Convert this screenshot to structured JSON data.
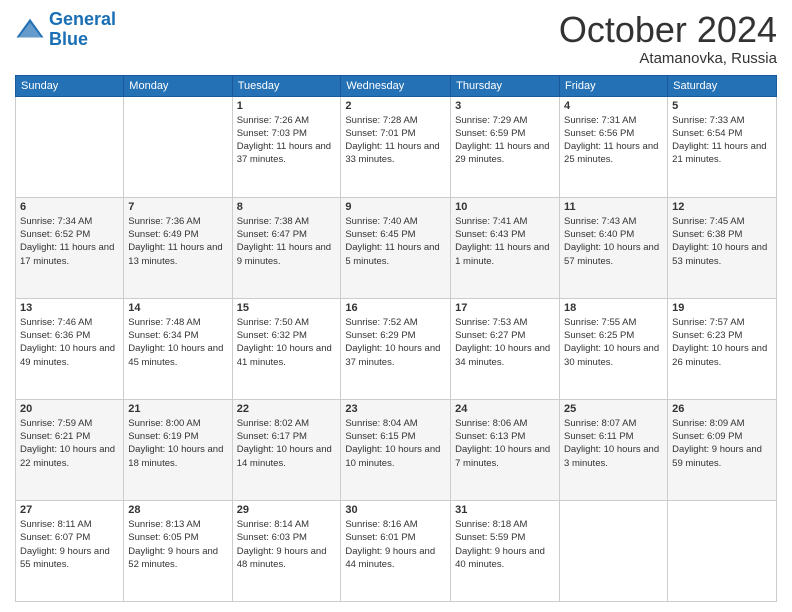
{
  "logo": {
    "line1": "General",
    "line2": "Blue"
  },
  "header": {
    "month": "October 2024",
    "location": "Atamanovka, Russia"
  },
  "days_of_week": [
    "Sunday",
    "Monday",
    "Tuesday",
    "Wednesday",
    "Thursday",
    "Friday",
    "Saturday"
  ],
  "weeks": [
    [
      {
        "day": "",
        "info": ""
      },
      {
        "day": "",
        "info": ""
      },
      {
        "day": "1",
        "info": "Sunrise: 7:26 AM\nSunset: 7:03 PM\nDaylight: 11 hours and 37 minutes."
      },
      {
        "day": "2",
        "info": "Sunrise: 7:28 AM\nSunset: 7:01 PM\nDaylight: 11 hours and 33 minutes."
      },
      {
        "day": "3",
        "info": "Sunrise: 7:29 AM\nSunset: 6:59 PM\nDaylight: 11 hours and 29 minutes."
      },
      {
        "day": "4",
        "info": "Sunrise: 7:31 AM\nSunset: 6:56 PM\nDaylight: 11 hours and 25 minutes."
      },
      {
        "day": "5",
        "info": "Sunrise: 7:33 AM\nSunset: 6:54 PM\nDaylight: 11 hours and 21 minutes."
      }
    ],
    [
      {
        "day": "6",
        "info": "Sunrise: 7:34 AM\nSunset: 6:52 PM\nDaylight: 11 hours and 17 minutes."
      },
      {
        "day": "7",
        "info": "Sunrise: 7:36 AM\nSunset: 6:49 PM\nDaylight: 11 hours and 13 minutes."
      },
      {
        "day": "8",
        "info": "Sunrise: 7:38 AM\nSunset: 6:47 PM\nDaylight: 11 hours and 9 minutes."
      },
      {
        "day": "9",
        "info": "Sunrise: 7:40 AM\nSunset: 6:45 PM\nDaylight: 11 hours and 5 minutes."
      },
      {
        "day": "10",
        "info": "Sunrise: 7:41 AM\nSunset: 6:43 PM\nDaylight: 11 hours and 1 minute."
      },
      {
        "day": "11",
        "info": "Sunrise: 7:43 AM\nSunset: 6:40 PM\nDaylight: 10 hours and 57 minutes."
      },
      {
        "day": "12",
        "info": "Sunrise: 7:45 AM\nSunset: 6:38 PM\nDaylight: 10 hours and 53 minutes."
      }
    ],
    [
      {
        "day": "13",
        "info": "Sunrise: 7:46 AM\nSunset: 6:36 PM\nDaylight: 10 hours and 49 minutes."
      },
      {
        "day": "14",
        "info": "Sunrise: 7:48 AM\nSunset: 6:34 PM\nDaylight: 10 hours and 45 minutes."
      },
      {
        "day": "15",
        "info": "Sunrise: 7:50 AM\nSunset: 6:32 PM\nDaylight: 10 hours and 41 minutes."
      },
      {
        "day": "16",
        "info": "Sunrise: 7:52 AM\nSunset: 6:29 PM\nDaylight: 10 hours and 37 minutes."
      },
      {
        "day": "17",
        "info": "Sunrise: 7:53 AM\nSunset: 6:27 PM\nDaylight: 10 hours and 34 minutes."
      },
      {
        "day": "18",
        "info": "Sunrise: 7:55 AM\nSunset: 6:25 PM\nDaylight: 10 hours and 30 minutes."
      },
      {
        "day": "19",
        "info": "Sunrise: 7:57 AM\nSunset: 6:23 PM\nDaylight: 10 hours and 26 minutes."
      }
    ],
    [
      {
        "day": "20",
        "info": "Sunrise: 7:59 AM\nSunset: 6:21 PM\nDaylight: 10 hours and 22 minutes."
      },
      {
        "day": "21",
        "info": "Sunrise: 8:00 AM\nSunset: 6:19 PM\nDaylight: 10 hours and 18 minutes."
      },
      {
        "day": "22",
        "info": "Sunrise: 8:02 AM\nSunset: 6:17 PM\nDaylight: 10 hours and 14 minutes."
      },
      {
        "day": "23",
        "info": "Sunrise: 8:04 AM\nSunset: 6:15 PM\nDaylight: 10 hours and 10 minutes."
      },
      {
        "day": "24",
        "info": "Sunrise: 8:06 AM\nSunset: 6:13 PM\nDaylight: 10 hours and 7 minutes."
      },
      {
        "day": "25",
        "info": "Sunrise: 8:07 AM\nSunset: 6:11 PM\nDaylight: 10 hours and 3 minutes."
      },
      {
        "day": "26",
        "info": "Sunrise: 8:09 AM\nSunset: 6:09 PM\nDaylight: 9 hours and 59 minutes."
      }
    ],
    [
      {
        "day": "27",
        "info": "Sunrise: 8:11 AM\nSunset: 6:07 PM\nDaylight: 9 hours and 55 minutes."
      },
      {
        "day": "28",
        "info": "Sunrise: 8:13 AM\nSunset: 6:05 PM\nDaylight: 9 hours and 52 minutes."
      },
      {
        "day": "29",
        "info": "Sunrise: 8:14 AM\nSunset: 6:03 PM\nDaylight: 9 hours and 48 minutes."
      },
      {
        "day": "30",
        "info": "Sunrise: 8:16 AM\nSunset: 6:01 PM\nDaylight: 9 hours and 44 minutes."
      },
      {
        "day": "31",
        "info": "Sunrise: 8:18 AM\nSunset: 5:59 PM\nDaylight: 9 hours and 40 minutes."
      },
      {
        "day": "",
        "info": ""
      },
      {
        "day": "",
        "info": ""
      }
    ]
  ]
}
